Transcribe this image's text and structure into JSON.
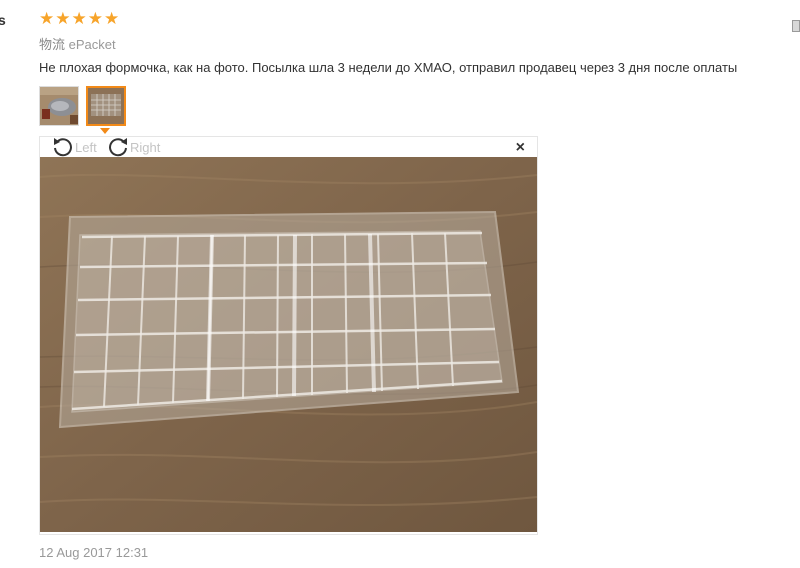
{
  "left_cut_text": "s",
  "review": {
    "stars": [
      "★",
      "★",
      "★",
      "★",
      "★"
    ],
    "logistics_label": "物流",
    "logistics_value": "ePacket",
    "text": "Не плохая формочка, как на фото. Посылка шла 3 недели до ХМАО, отправил продавец через 3 дня после оплаты",
    "date": "12 Aug 2017 12:31"
  },
  "viewer": {
    "rotate_left": "Left",
    "rotate_right": "Right",
    "close": "×"
  },
  "colors": {
    "star": "#f7a42a",
    "active_border": "#f28a18",
    "wood": "#8c7156"
  }
}
